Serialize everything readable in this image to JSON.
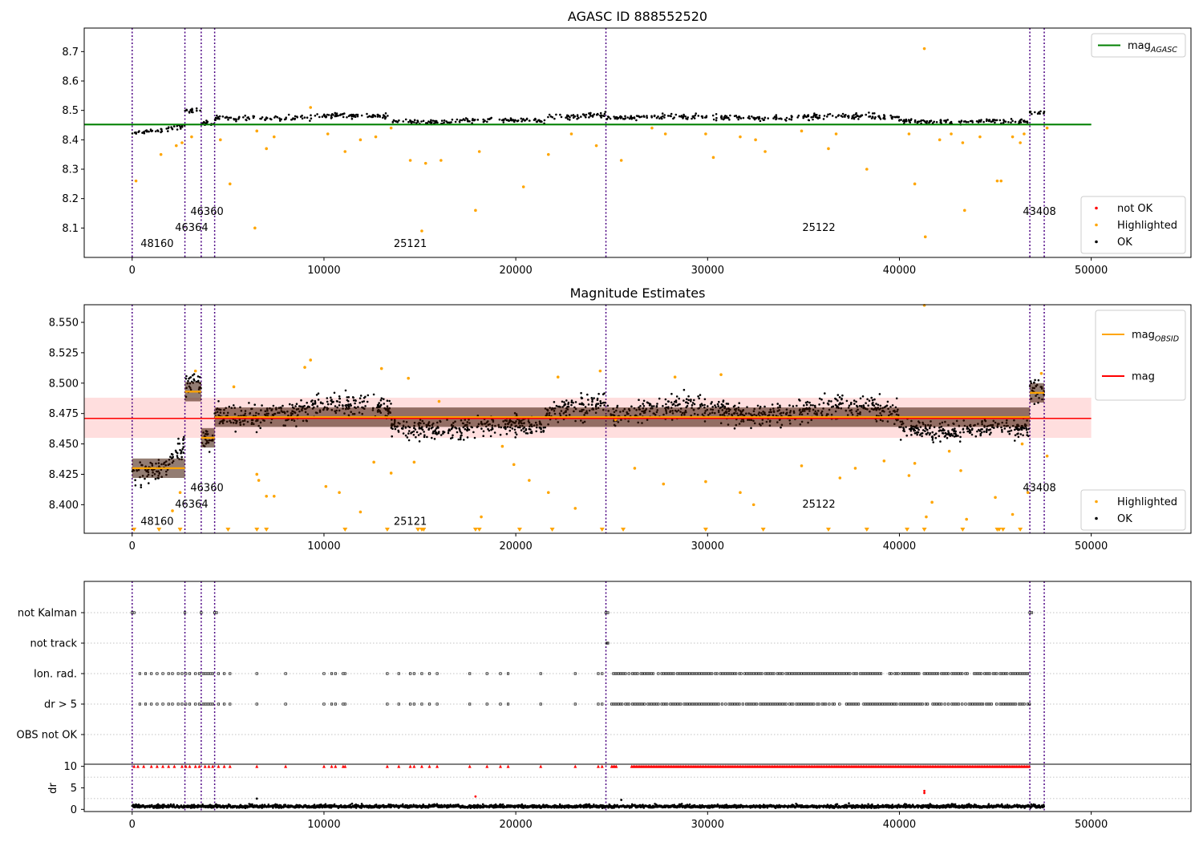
{
  "chart_data": [
    {
      "type": "scatter",
      "title": "AGASC ID 888552520",
      "xlim": [
        -2500,
        55200
      ],
      "ylim": [
        8.0,
        8.78
      ],
      "xticks": [
        0,
        10000,
        20000,
        30000,
        40000,
        50000
      ],
      "yticks": [
        8.1,
        8.2,
        8.3,
        8.4,
        8.5,
        8.6,
        8.7
      ],
      "obs_boundaries": [
        0,
        2750,
        3600,
        4300,
        24700,
        46800,
        47550
      ],
      "obs_labels": [
        {
          "text": "48160",
          "x": 1300,
          "y": 8.035
        },
        {
          "text": "46364",
          "x": 3100,
          "y": 8.09
        },
        {
          "text": "46360",
          "x": 3900,
          "y": 8.145
        },
        {
          "text": "25121",
          "x": 14500,
          "y": 8.035
        },
        {
          "text": "25122",
          "x": 35800,
          "y": 8.09
        },
        {
          "text": "43408",
          "x": 47300,
          "y": 8.145
        }
      ],
      "segments": [
        {
          "x0": 0,
          "x1": 1500,
          "level0": 8.425,
          "level1": 8.425,
          "spread": 0.012
        },
        {
          "x0": 1500,
          "x1": 2750,
          "level0": 8.425,
          "level1": 8.445,
          "spread": 0.012
        },
        {
          "x0": 2750,
          "x1": 3600,
          "level0": 8.497,
          "level1": 8.497,
          "spread": 0.012
        },
        {
          "x0": 3600,
          "x1": 4300,
          "level0": 8.455,
          "level1": 8.455,
          "spread": 0.01
        },
        {
          "x0": 4300,
          "x1": 13500,
          "level0": 8.475,
          "level1": 8.48,
          "spread": 0.012
        },
        {
          "x0": 13500,
          "x1": 21500,
          "level0": 8.466,
          "level1": 8.462,
          "spread": 0.011
        },
        {
          "x0": 21500,
          "x1": 24700,
          "level0": 8.475,
          "level1": 8.49,
          "spread": 0.013
        },
        {
          "x0": 24700,
          "x1": 40000,
          "level0": 8.477,
          "level1": 8.477,
          "spread": 0.012
        },
        {
          "x0": 40000,
          "x1": 46800,
          "level0": 8.466,
          "level1": 8.46,
          "spread": 0.01
        },
        {
          "x0": 46800,
          "x1": 47550,
          "level0": 8.492,
          "level1": 8.492,
          "spread": 0.012
        }
      ],
      "highlighted_points": [
        [
          200,
          8.26
        ],
        [
          1500,
          8.35
        ],
        [
          2300,
          8.38
        ],
        [
          2600,
          8.39
        ],
        [
          3100,
          8.41
        ],
        [
          4600,
          8.4
        ],
        [
          5100,
          8.25
        ],
        [
          6400,
          8.1
        ],
        [
          6500,
          8.43
        ],
        [
          7000,
          8.37
        ],
        [
          7400,
          8.41
        ],
        [
          9300,
          8.51
        ],
        [
          10200,
          8.42
        ],
        [
          11100,
          8.36
        ],
        [
          11900,
          8.4
        ],
        [
          12700,
          8.41
        ],
        [
          13500,
          8.44
        ],
        [
          14500,
          8.33
        ],
        [
          15100,
          8.09
        ],
        [
          15300,
          8.32
        ],
        [
          16100,
          8.33
        ],
        [
          17900,
          8.16
        ],
        [
          18100,
          8.36
        ],
        [
          20400,
          8.24
        ],
        [
          21700,
          8.35
        ],
        [
          22900,
          8.42
        ],
        [
          24200,
          8.38
        ],
        [
          25500,
          8.33
        ],
        [
          27100,
          8.44
        ],
        [
          27800,
          8.42
        ],
        [
          29900,
          8.42
        ],
        [
          30300,
          8.34
        ],
        [
          31700,
          8.41
        ],
        [
          32500,
          8.4
        ],
        [
          33000,
          8.36
        ],
        [
          34900,
          8.43
        ],
        [
          36300,
          8.37
        ],
        [
          36700,
          8.42
        ],
        [
          38300,
          8.3
        ],
        [
          40500,
          8.42
        ],
        [
          40800,
          8.25
        ],
        [
          41300,
          8.71
        ],
        [
          41350,
          8.07
        ],
        [
          42100,
          8.4
        ],
        [
          42700,
          8.42
        ],
        [
          43300,
          8.39
        ],
        [
          43400,
          8.16
        ],
        [
          44200,
          8.41
        ],
        [
          45100,
          8.26
        ],
        [
          45300,
          8.26
        ],
        [
          45900,
          8.41
        ],
        [
          46300,
          8.39
        ],
        [
          46500,
          8.42
        ],
        [
          47700,
          8.44
        ]
      ],
      "hlines": [
        {
          "name": "mag_AGASC",
          "y": 8.452,
          "x0": -2500,
          "x1": 50000,
          "color": "#008000"
        }
      ],
      "legend_upper": [
        {
          "text": "mag",
          "subscript": "AGASC",
          "marker": "line",
          "color": "#008000"
        }
      ],
      "legend_lower": [
        {
          "text": "not OK",
          "marker": "dot",
          "color": "#ff0000"
        },
        {
          "text": "Highlighted",
          "marker": "dot",
          "color": "#ffa500"
        },
        {
          "text": "OK",
          "marker": "dot",
          "color": "#000000"
        }
      ]
    },
    {
      "type": "scatter",
      "title": "Magnitude Estimates",
      "xlim": [
        -2500,
        55200
      ],
      "ylim": [
        8.3765,
        8.5645
      ],
      "xticks": [
        0,
        10000,
        20000,
        30000,
        40000,
        50000
      ],
      "yticks": [
        8.4,
        8.425,
        8.45,
        8.475,
        8.5,
        8.525,
        8.55
      ],
      "ytick_labels": [
        "8.400",
        "8.425",
        "8.450",
        "8.475",
        "8.500",
        "8.525",
        "8.550"
      ],
      "obs_boundaries": [
        0,
        2750,
        3600,
        4300,
        24700,
        46800,
        47550
      ],
      "obs_labels": [
        {
          "text": "48160",
          "x": 1300,
          "y": 8.3835
        },
        {
          "text": "46364",
          "x": 3100,
          "y": 8.3975
        },
        {
          "text": "46360",
          "x": 3900,
          "y": 8.411
        },
        {
          "text": "25121",
          "x": 14500,
          "y": 8.3835
        },
        {
          "text": "25122",
          "x": 35800,
          "y": 8.3975
        },
        {
          "text": "43408",
          "x": 47300,
          "y": 8.411
        }
      ],
      "mag": 8.471,
      "mag_band": [
        8.455,
        8.488
      ],
      "obsid_mags": [
        {
          "x0": 0,
          "x1": 2750,
          "y": 8.43
        },
        {
          "x0": 2750,
          "x1": 3600,
          "y": 8.493
        },
        {
          "x0": 3600,
          "x1": 4300,
          "y": 8.455
        },
        {
          "x0": 4300,
          "x1": 24700,
          "y": 8.472
        },
        {
          "x0": 24700,
          "x1": 46800,
          "y": 8.472
        },
        {
          "x0": 46800,
          "x1": 47550,
          "y": 8.492
        }
      ],
      "segments": [
        {
          "x0": 0,
          "x1": 1500,
          "level0": 8.425,
          "level1": 8.425,
          "spread": 0.012
        },
        {
          "x0": 1500,
          "x1": 2750,
          "level0": 8.425,
          "level1": 8.445,
          "spread": 0.012
        },
        {
          "x0": 2750,
          "x1": 3600,
          "level0": 8.497,
          "level1": 8.497,
          "spread": 0.012
        },
        {
          "x0": 3600,
          "x1": 4300,
          "level0": 8.455,
          "level1": 8.455,
          "spread": 0.01
        },
        {
          "x0": 4300,
          "x1": 13500,
          "level0": 8.475,
          "level1": 8.48,
          "spread": 0.012
        },
        {
          "x0": 13500,
          "x1": 21500,
          "level0": 8.466,
          "level1": 8.462,
          "spread": 0.011
        },
        {
          "x0": 21500,
          "x1": 24700,
          "level0": 8.475,
          "level1": 8.49,
          "spread": 0.013
        },
        {
          "x0": 24700,
          "x1": 40000,
          "level0": 8.477,
          "level1": 8.477,
          "spread": 0.012
        },
        {
          "x0": 40000,
          "x1": 46800,
          "level0": 8.466,
          "level1": 8.46,
          "spread": 0.01
        },
        {
          "x0": 46800,
          "x1": 47550,
          "level0": 8.492,
          "level1": 8.492,
          "spread": 0.012
        }
      ],
      "highlighted_points": [
        [
          2100,
          8.395
        ],
        [
          2500,
          8.41
        ],
        [
          3300,
          8.51
        ],
        [
          5300,
          8.497
        ],
        [
          6500,
          8.425
        ],
        [
          6600,
          8.42
        ],
        [
          7000,
          8.407
        ],
        [
          7400,
          8.407
        ],
        [
          9000,
          8.513
        ],
        [
          9300,
          8.519
        ],
        [
          10100,
          8.415
        ],
        [
          10800,
          8.41
        ],
        [
          11900,
          8.394
        ],
        [
          12600,
          8.435
        ],
        [
          13000,
          8.512
        ],
        [
          13500,
          8.426
        ],
        [
          14400,
          8.504
        ],
        [
          14700,
          8.435
        ],
        [
          16000,
          8.485
        ],
        [
          18200,
          8.39
        ],
        [
          19300,
          8.448
        ],
        [
          19900,
          8.433
        ],
        [
          20700,
          8.42
        ],
        [
          21700,
          8.41
        ],
        [
          22200,
          8.505
        ],
        [
          23100,
          8.397
        ],
        [
          24400,
          8.51
        ],
        [
          25200,
          8.47
        ],
        [
          26200,
          8.43
        ],
        [
          27700,
          8.417
        ],
        [
          28300,
          8.505
        ],
        [
          29900,
          8.419
        ],
        [
          30700,
          8.507
        ],
        [
          31700,
          8.41
        ],
        [
          32400,
          8.4
        ],
        [
          34900,
          8.432
        ],
        [
          36900,
          8.422
        ],
        [
          37700,
          8.43
        ],
        [
          39200,
          8.436
        ],
        [
          40500,
          8.424
        ],
        [
          40800,
          8.434
        ],
        [
          41300,
          8.564
        ],
        [
          41400,
          8.39
        ],
        [
          41700,
          8.402
        ],
        [
          42600,
          8.444
        ],
        [
          43200,
          8.428
        ],
        [
          43500,
          8.388
        ],
        [
          45000,
          8.406
        ],
        [
          45900,
          8.392
        ],
        [
          46400,
          8.45
        ],
        [
          46700,
          8.41
        ],
        [
          47400,
          8.508
        ],
        [
          47700,
          8.44
        ]
      ],
      "lower_markers_x": [
        100,
        1400,
        2500,
        5000,
        6500,
        7000,
        11100,
        13300,
        14900,
        15100,
        15200,
        17900,
        18100,
        20200,
        21900,
        24500,
        25600,
        29900,
        32900,
        36300,
        38300,
        40400,
        41300,
        43300,
        45100,
        45200,
        45400,
        46300
      ],
      "legend_upper": [
        {
          "text": "mag",
          "subscript": "OBSID",
          "marker": "line",
          "color": "#ffa500"
        },
        {
          "text": "mag",
          "subscript": "",
          "marker": "line",
          "color": "#ff0000"
        }
      ],
      "legend_lower": [
        {
          "text": "Highlighted",
          "marker": "dot",
          "color": "#ffa500"
        },
        {
          "text": "OK",
          "marker": "dot",
          "color": "#000000"
        }
      ]
    },
    {
      "type": "scatter",
      "xlim": [
        -2500,
        55200
      ],
      "categories": [
        "not Kalman",
        "not track",
        "Ion. rad.",
        "dr > 5",
        "OBS not OK"
      ],
      "obs_boundaries": [
        0,
        2750,
        3600,
        4300,
        24700,
        46800,
        47550
      ],
      "flag_points": {
        "not Kalman": [
          0,
          100,
          2750,
          3600,
          4300,
          4400,
          24700,
          24800,
          46800,
          46900
        ],
        "not track": [
          24750,
          24800
        ],
        "Ion. rad.": [
          400,
          700,
          1000,
          1300,
          1600,
          1900,
          2100,
          2400,
          2600,
          2800,
          3000,
          3300,
          3500,
          3700,
          3800,
          3900,
          4000,
          4100,
          4200,
          4500,
          4800,
          5100,
          6500,
          8000,
          10000,
          10400,
          10600,
          11000,
          11100,
          13300,
          13900,
          14500,
          14700,
          15100,
          15500,
          15900,
          17600,
          18500,
          19200,
          19600,
          21300,
          23100,
          24300,
          24500
        ],
        "dr > 5": [
          400,
          700,
          1000,
          1300,
          1600,
          1900,
          2100,
          2400,
          2600,
          2800,
          3000,
          3300,
          3500,
          3700,
          3800,
          3900,
          4000,
          4100,
          4200,
          4500,
          4800,
          5100,
          6500,
          8000,
          10000,
          10400,
          10600,
          11000,
          11100,
          13300,
          13900,
          14500,
          14700,
          15100,
          15500,
          15900,
          17600,
          18500,
          19200,
          19600,
          21300,
          23100,
          24300,
          24500
        ]
      },
      "dense_ranges": {
        "x0": 25000,
        "x1": 46800,
        "x2": 26000
      },
      "obs_not_ok": []
    },
    {
      "type": "scatter",
      "ylabel": "dr",
      "xlim": [
        -2500,
        55200
      ],
      "ylim": [
        -0.5,
        10.5
      ],
      "yticks": [
        0,
        5,
        10
      ],
      "xticks": [
        0,
        10000,
        20000,
        30000,
        40000,
        50000
      ],
      "obs_boundaries": [
        0,
        2750,
        3600,
        4300,
        24700,
        46800,
        47550
      ],
      "data_range": [
        0,
        47550
      ],
      "outliers": [
        [
          6500,
          2.5
        ],
        [
          17900,
          3.0
        ],
        [
          41300,
          3.8
        ],
        [
          41300,
          4.3
        ],
        [
          25500,
          2.2
        ]
      ],
      "red_ten_x": [
        100,
        300,
        600,
        1000,
        1300,
        1600,
        1900,
        2200,
        2600,
        2800,
        3000,
        3300,
        3500,
        3800,
        4000,
        4200,
        4500,
        4800,
        5100,
        6500,
        8000,
        10000,
        10400,
        10600,
        11000,
        11100,
        13300,
        13900,
        14500,
        14700,
        15100,
        15500,
        15900,
        17600,
        18500,
        19200,
        19600,
        21300,
        23100,
        24300,
        24500
      ]
    }
  ]
}
